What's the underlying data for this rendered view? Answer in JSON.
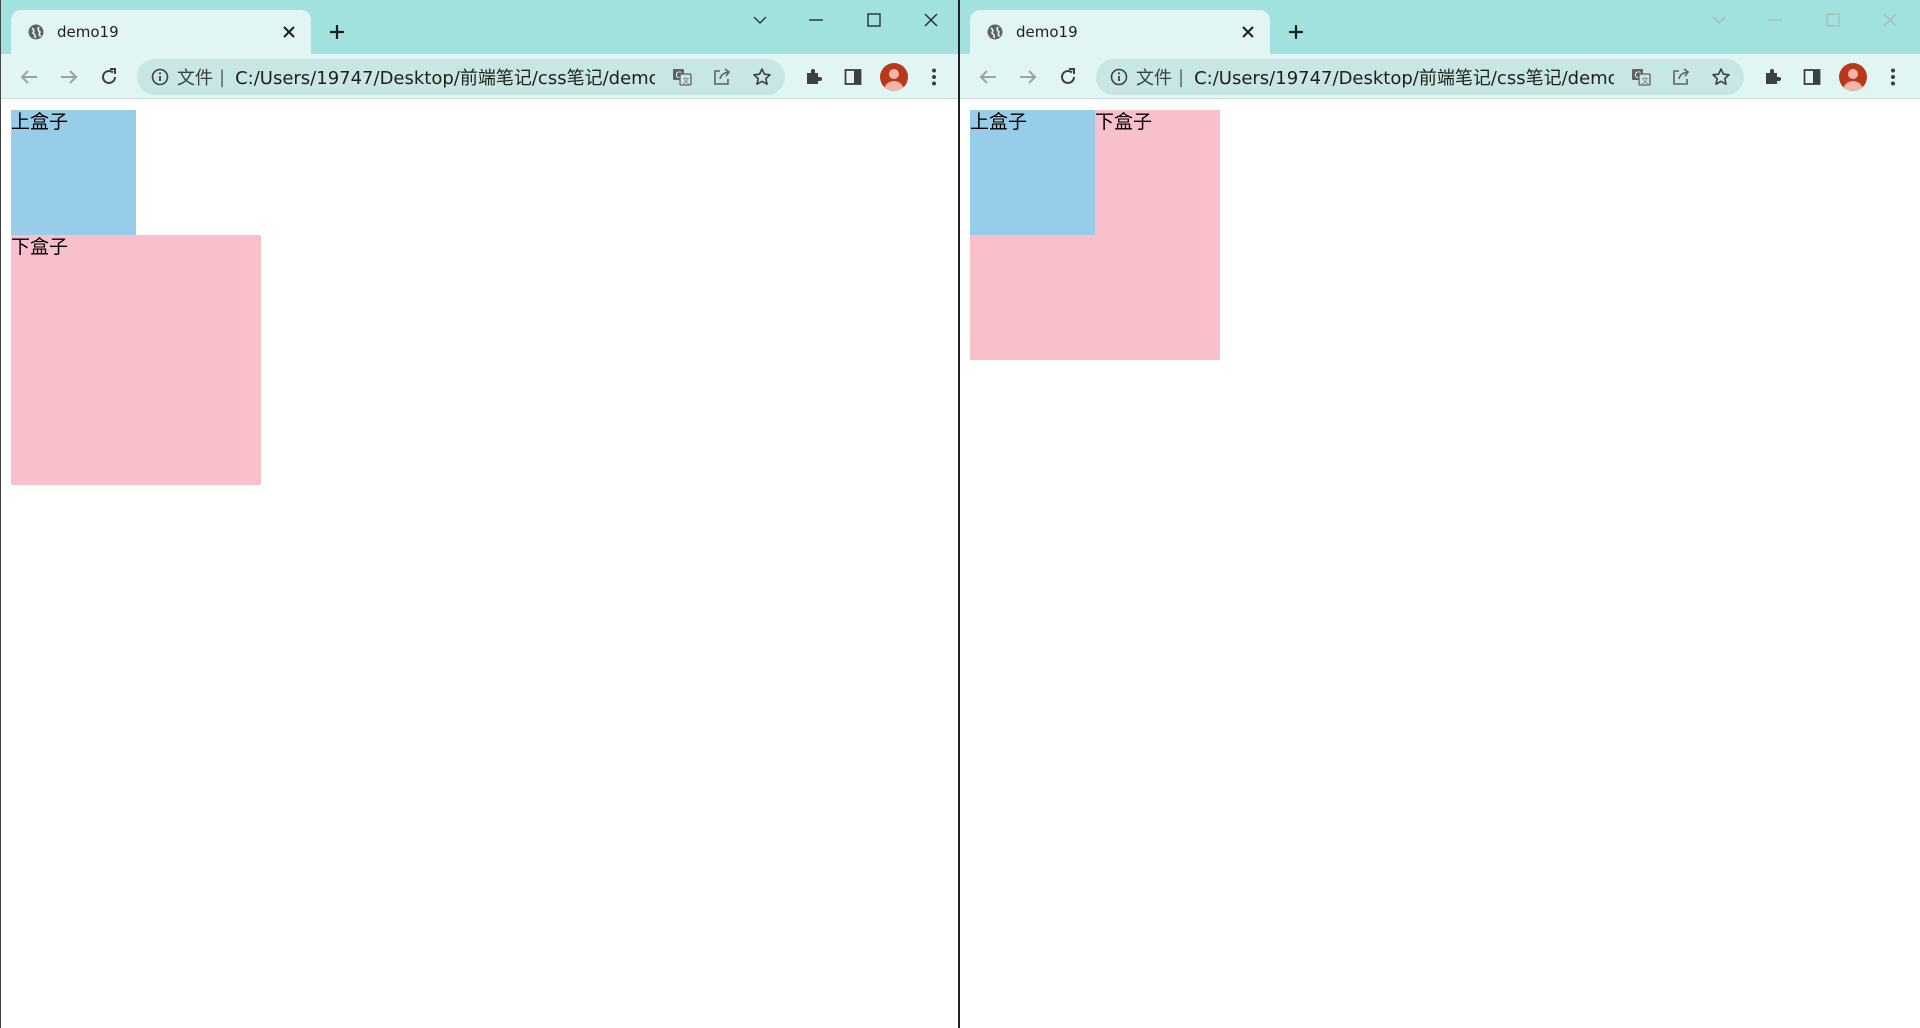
{
  "left_window": {
    "tab_title": "demo19",
    "omnibox": {
      "scheme_label": "文件",
      "separator": "|",
      "url": "C:/Users/19747/Desktop/前端笔记/css笔记/demo..."
    },
    "content": {
      "upper_box_label": "上盒子",
      "lower_box_label": "下盒子"
    }
  },
  "right_window": {
    "tab_title": "demo19",
    "omnibox": {
      "scheme_label": "文件",
      "separator": "|",
      "url": "C:/Users/19747/Desktop/前端笔记/css笔记/demo..."
    },
    "content": {
      "upper_box_label": "上盒子",
      "lower_box_label": "下盒子"
    }
  },
  "colors": {
    "titlebar": "#a1e2de",
    "toolbar": "#e0f5f4",
    "upper_box": "#98cdea",
    "lower_box": "#f7c0cb",
    "avatar": "#b8391a"
  },
  "icons": [
    "globe-icon",
    "close-icon",
    "plus-icon",
    "chevron-down-icon",
    "minimize-icon",
    "maximize-icon",
    "window-close-icon",
    "back-arrow-icon",
    "forward-arrow-icon",
    "reload-icon",
    "info-icon",
    "translate-icon",
    "share-icon",
    "star-icon",
    "puzzle-icon",
    "side-panel-icon",
    "kebab-menu-icon"
  ]
}
